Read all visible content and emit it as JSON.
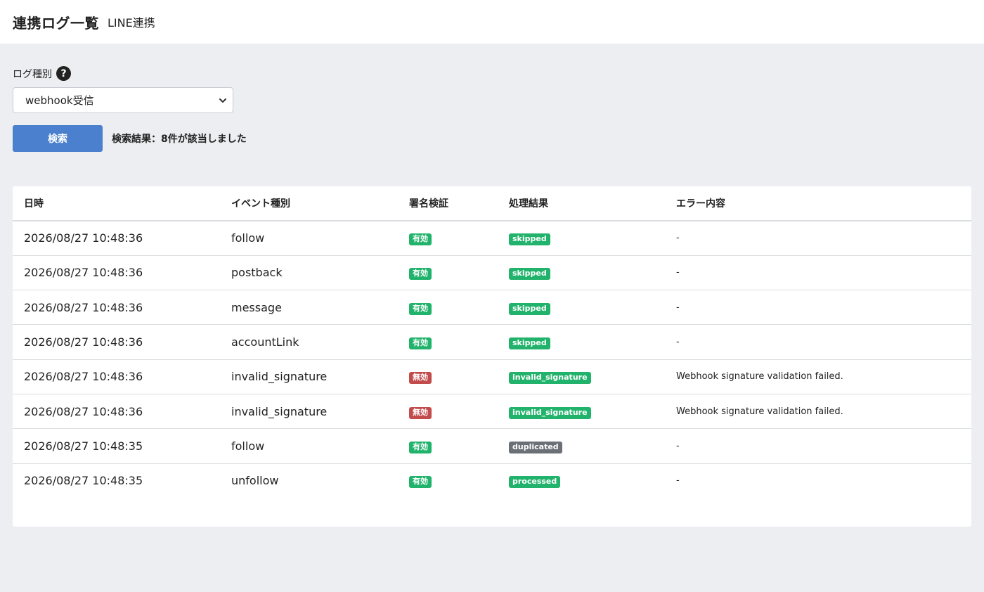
{
  "header": {
    "title": "連携ログ一覧",
    "subtitle": "LINE連携"
  },
  "filter": {
    "label": "ログ種別",
    "help_icon": "?",
    "selected": "webhook受信",
    "search_button": "検索",
    "result_text": "検索結果：8件が該当しました"
  },
  "colors": {
    "success": "#21b36b",
    "danger": "#c24b4b",
    "secondary": "#6b6f76",
    "primary_button": "#4a80cd"
  },
  "table": {
    "headers": [
      "日時",
      "イベント種別",
      "署名検証",
      "処理結果",
      "エラー内容"
    ],
    "rows": [
      {
        "datetime": "2026/08/27 10:48:36",
        "event": "follow",
        "signature": "有効",
        "signature_color": "#21b36b",
        "result": "skipped",
        "result_color": "#21b36b",
        "error": "-"
      },
      {
        "datetime": "2026/08/27 10:48:36",
        "event": "postback",
        "signature": "有効",
        "signature_color": "#21b36b",
        "result": "skipped",
        "result_color": "#21b36b",
        "error": "-"
      },
      {
        "datetime": "2026/08/27 10:48:36",
        "event": "message",
        "signature": "有効",
        "signature_color": "#21b36b",
        "result": "skipped",
        "result_color": "#21b36b",
        "error": "-"
      },
      {
        "datetime": "2026/08/27 10:48:36",
        "event": "accountLink",
        "signature": "有効",
        "signature_color": "#21b36b",
        "result": "skipped",
        "result_color": "#21b36b",
        "error": "-"
      },
      {
        "datetime": "2026/08/27 10:48:36",
        "event": "invalid_signature",
        "signature": "無効",
        "signature_color": "#c24b4b",
        "result": "invalid_signature",
        "result_color": "#21b36b",
        "error": "Webhook signature validation failed."
      },
      {
        "datetime": "2026/08/27 10:48:36",
        "event": "invalid_signature",
        "signature": "無効",
        "signature_color": "#c24b4b",
        "result": "invalid_signature",
        "result_color": "#21b36b",
        "error": "Webhook signature validation failed."
      },
      {
        "datetime": "2026/08/27 10:48:35",
        "event": "follow",
        "signature": "有効",
        "signature_color": "#21b36b",
        "result": "duplicated",
        "result_color": "#6b6f76",
        "error": "-"
      },
      {
        "datetime": "2026/08/27 10:48:35",
        "event": "unfollow",
        "signature": "有効",
        "signature_color": "#21b36b",
        "result": "processed",
        "result_color": "#21b36b",
        "error": "-"
      }
    ]
  }
}
